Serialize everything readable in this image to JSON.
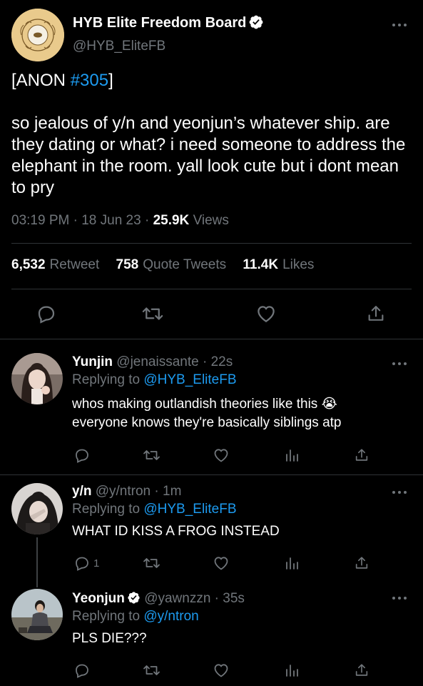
{
  "main_tweet": {
    "name": "HYB Elite Freedom Board",
    "handle": "@HYB_EliteFB",
    "text_prefix": "[ANON ",
    "hashtag": "#305",
    "text_suffix": "]",
    "body": "so jealous of y/n and yeonjun’s whatever ship. are they dating or what? i need someone to address the elephant in the room. yall look cute but i dont mean to pry",
    "time": "03:19 PM",
    "date": "18 Jun 23",
    "views_count": "25.9K",
    "views_label": "Views",
    "retweets": "6,532",
    "retweets_label": "Retweet",
    "quotes": "758",
    "quotes_label": "Quote Tweets",
    "likes": "11.4K",
    "likes_label": "Likes"
  },
  "replies": [
    {
      "name": "Yunjin",
      "handle": "@jenaissante",
      "time": "22s",
      "replying_label": "Replying to",
      "replying_to": "@HYB_EliteFB",
      "text": "whos making outlandish theories like this 😭\neveryone knows they're basically siblings atp",
      "reply_count": ""
    },
    {
      "name": "y/n",
      "handle": "@y/ntron",
      "time": "1m",
      "replying_label": "Replying to",
      "replying_to": "@HYB_EliteFB",
      "text": "WHAT ID KISS A FROG INSTEAD",
      "reply_count": "1"
    },
    {
      "name": "Yeonjun",
      "handle": "@yawnzzn",
      "time": "35s",
      "replying_label": "Replying to",
      "replying_to": "@y/ntron",
      "text": "PLS DIE???",
      "reply_count": ""
    }
  ],
  "icons": {
    "reply": "reply-icon",
    "retweet": "retweet-icon",
    "like": "heart-icon",
    "views": "views-icon",
    "share": "share-icon",
    "more": "more-icon",
    "verified": "verified-icon"
  },
  "colors": {
    "background": "#000000",
    "text": "#e7e9ea",
    "muted": "#71767b",
    "link": "#1d9bf0",
    "divider": "#2f3336"
  }
}
